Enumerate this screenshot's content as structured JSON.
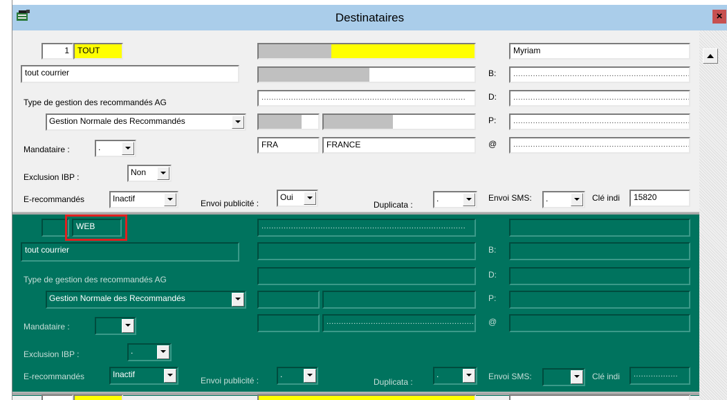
{
  "window": {
    "title": "Destinataires",
    "close_glyph": "×",
    "icon": "app-icon"
  },
  "record1": {
    "number": "1",
    "code": "TOUT",
    "name": "Myriam",
    "courrier": "tout courrier",
    "type_label": "Type de gestion des recommandés AG",
    "gestion_value": "Gestion Normale des Recommandés",
    "mandataire_label": "Mandataire :",
    "mandataire_value": ".",
    "exclusion_label": "Exclusion IBP :",
    "exclusion_value": "Non",
    "erec_label": "E-recommandés",
    "erec_value": "Inactif",
    "pub_label": "Envoi publicité :",
    "pub_value": "Oui",
    "dup_label": "Duplicata :",
    "dup_value": ".",
    "sms_label": "Envoi SMS:",
    "sms_value": ".",
    "cle_label": "Clé indi",
    "cle_value": "15820",
    "country_code": "FRA",
    "country_name": "FRANCE",
    "b_label": "B:",
    "d_label": "D:",
    "p_label": "P:",
    "at_label": "@",
    "dots": "..................................................................................."
  },
  "record2": {
    "code": "WEB",
    "courrier": "tout courrier",
    "type_label": "Type de gestion des recommandés AG",
    "gestion_value": "Gestion Normale des Recommandés",
    "mandataire_label": "Mandataire :",
    "mandataire_value": "",
    "exclusion_label": "Exclusion IBP :",
    "exclusion_value": ".",
    "erec_label": "E-recommandés",
    "erec_value": "Inactif",
    "pub_label": "Envoi publicité :",
    "pub_value": ".",
    "dup_label": "Duplicata :",
    "dup_value": ".",
    "sms_label": "Envoi SMS:",
    "sms_value": "",
    "cle_label": "Clé indi",
    "cle_value": "..................",
    "b_label": "B:",
    "d_label": "D:",
    "p_label": "P:",
    "at_label": "@",
    "dots": "..................................................................................."
  },
  "colors": {
    "accent_yellow": "#ffff00",
    "record_green": "#00735e",
    "highlight_red": "#e02020",
    "title_bar": "#aacdea"
  }
}
